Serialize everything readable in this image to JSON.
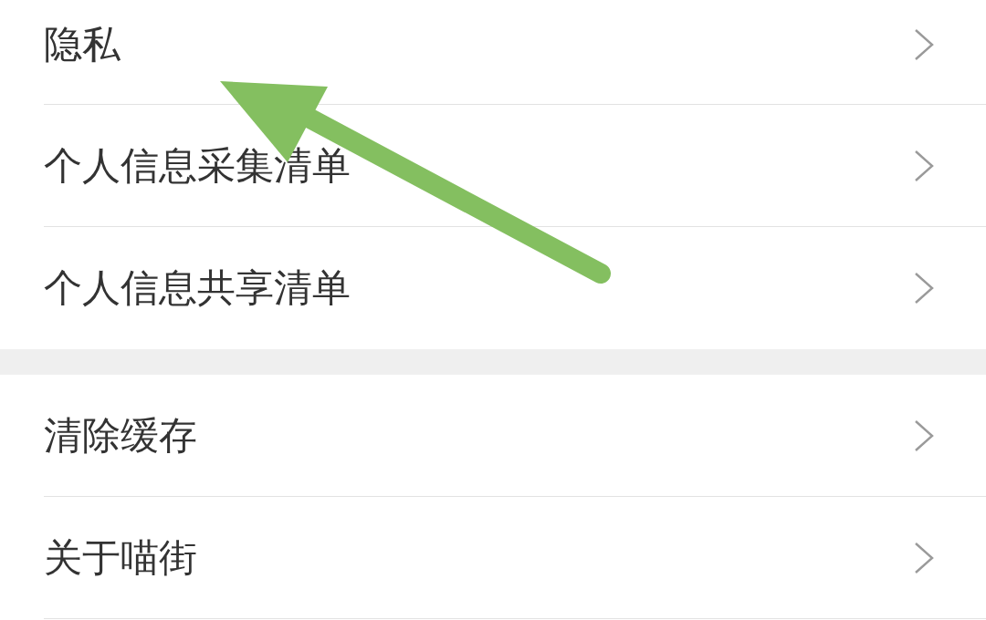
{
  "groups": [
    {
      "items": [
        {
          "label": "隐私"
        },
        {
          "label": "个人信息采集清单"
        },
        {
          "label": "个人信息共享清单"
        }
      ]
    },
    {
      "items": [
        {
          "label": "清除缓存"
        },
        {
          "label": "关于喵街"
        }
      ]
    }
  ]
}
